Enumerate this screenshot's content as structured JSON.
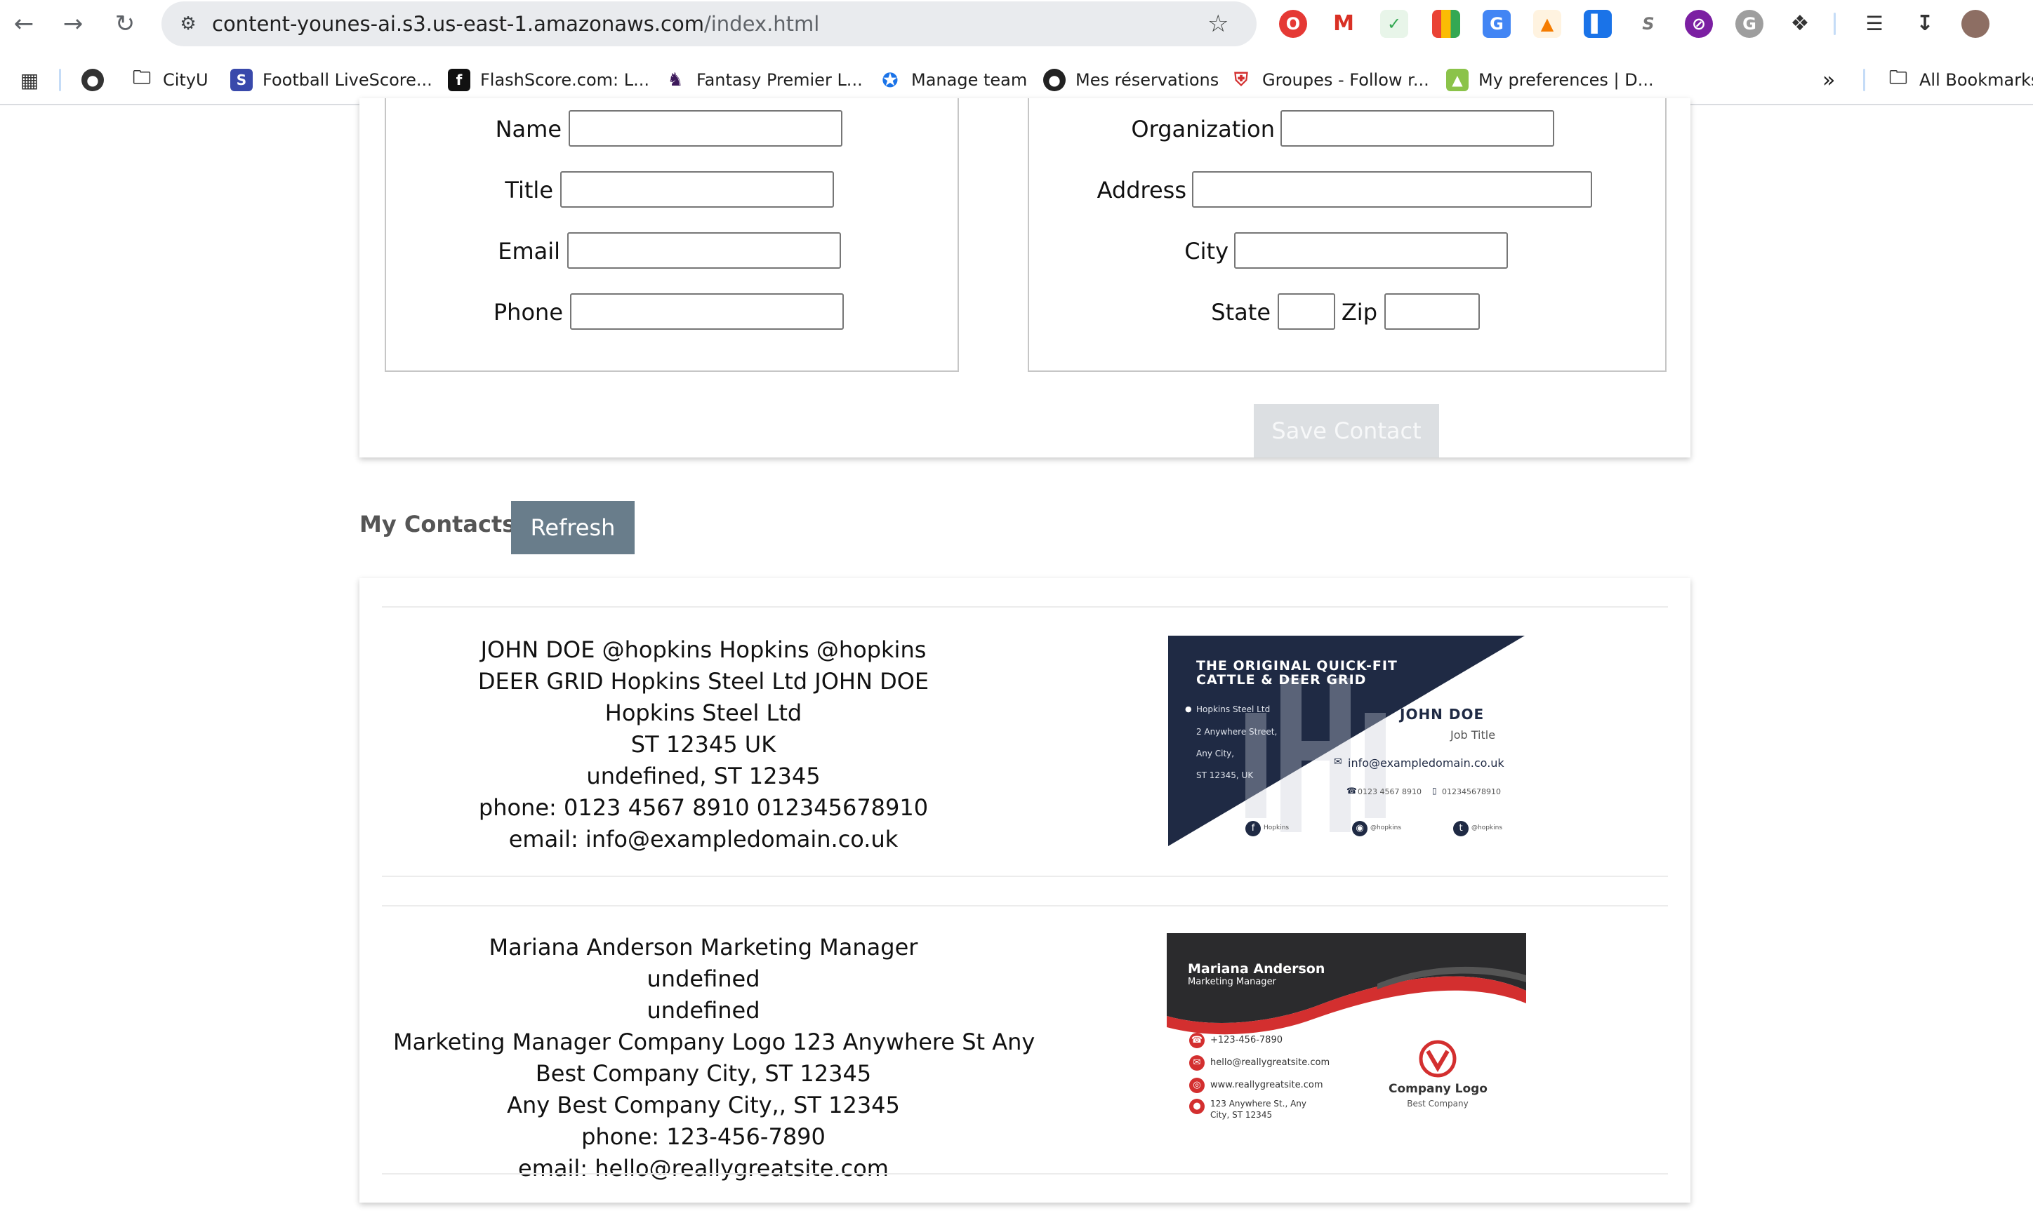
{
  "browser": {
    "url_host": "content-younes-ai.s3.us-east-1.amazonaws.com",
    "url_path": "/index.html",
    "bookmarks": [
      "CityU",
      "Football LiveScore...",
      "FlashScore.com: L...",
      "Fantasy Premier L...",
      "Manage team",
      "Mes réservations",
      "Groupes - Follow r...",
      "My preferences | D...",
      "All Bookmarks"
    ]
  },
  "form": {
    "name_label": "Name",
    "title_label": "Title",
    "email_label": "Email",
    "phone_label": "Phone",
    "organization_label": "Organization",
    "address_label": "Address",
    "city_label": "City",
    "state_label": "State",
    "zip_label": "Zip",
    "save_label": "Save Contact"
  },
  "contacts_section": {
    "heading": "My Contacts",
    "refresh_label": "Refresh"
  },
  "contacts": [
    {
      "lines": [
        "JOHN DOE @hopkins Hopkins @hopkins",
        "DEER GRID Hopkins Steel Ltd JOHN DOE",
        "Hopkins Steel Ltd",
        "ST 12345 UK",
        "undefined, ST 12345",
        "phone: 0123 4567 8910 012345678910",
        "email: info@exampledomain.co.uk"
      ],
      "card": {
        "headline_1": "THE ORIGINAL QUICK-FIT",
        "headline_2": "CATTLE & DEER GRID",
        "addr_1": "Hopkins Steel Ltd",
        "addr_2": "2 Anywhere Street,",
        "addr_3": "Any City,",
        "addr_4": "ST 12345, UK",
        "name": "JOHN DOE",
        "job": "Job Title",
        "email": "info@exampledomain.co.uk",
        "phone_1": "0123 4567 8910",
        "phone_2": "012345678910",
        "social_1": "Hopkins",
        "social_2": "@hopkins",
        "social_3": "@hopkins",
        "navy": "#1f2a44"
      }
    },
    {
      "lines": [
        "Mariana Anderson Marketing Manager",
        "undefined",
        "undefined",
        "Marketing Manager Company Logo 123 Anywhere St Any",
        "Best Company City, ST 12345",
        "Any Best Company City,, ST 12345",
        "phone: 123-456-7890",
        "email: hello@reallygreatsite.com"
      ],
      "card": {
        "name": "Mariana Anderson",
        "job": "Marketing Manager",
        "phone": "+123-456-7890",
        "email": "hello@reallygreatsite.com",
        "web": "www.reallygreatsite.com",
        "addr_1": "123 Anywhere St., Any",
        "addr_2": "City, ST 12345",
        "logo_title": "Company Logo",
        "logo_sub": "Best Company",
        "accent": "#d32f2f",
        "dark": "#2b2b2d"
      }
    }
  ]
}
